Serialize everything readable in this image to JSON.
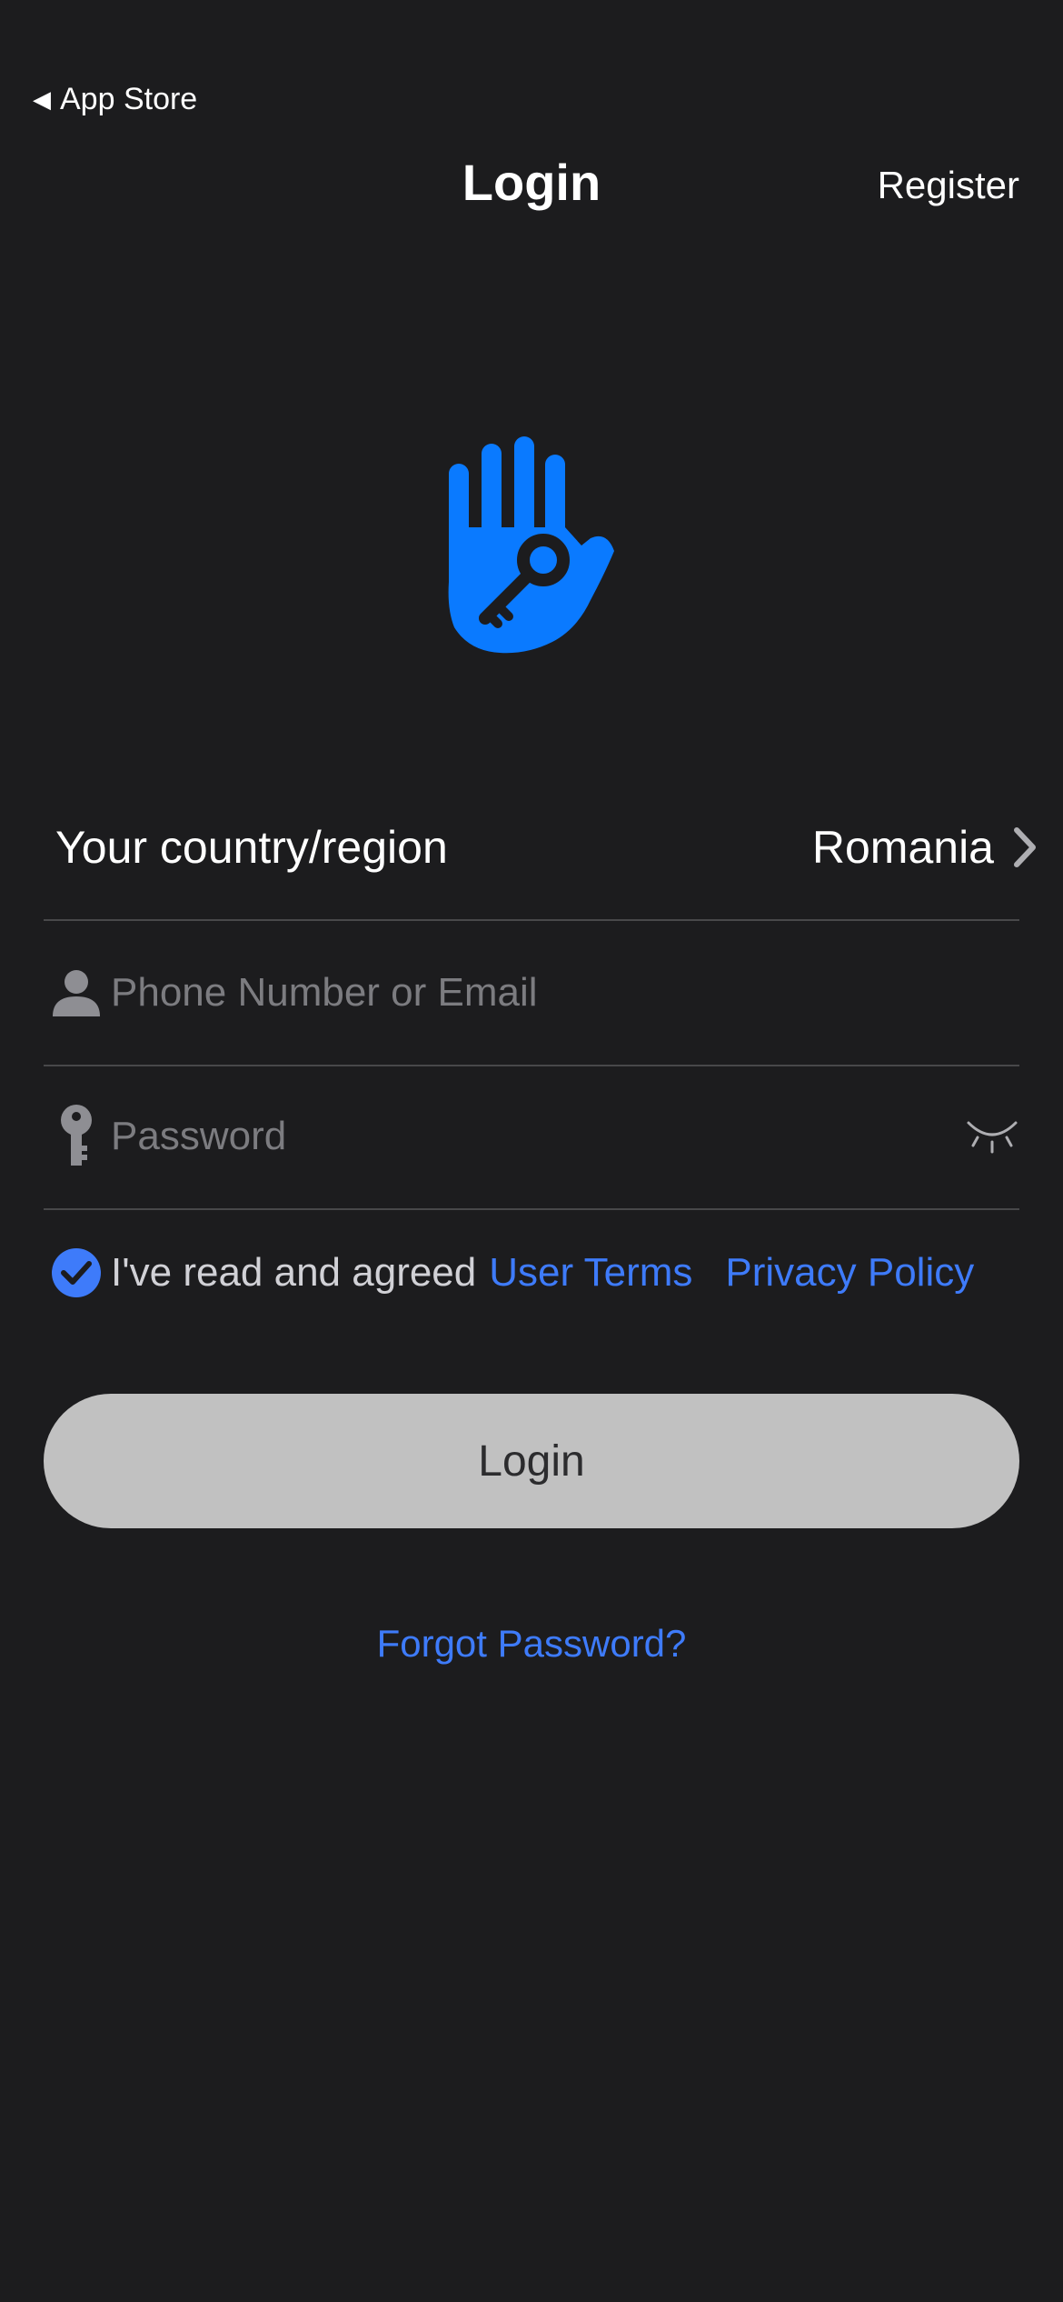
{
  "status": {
    "back_label": "App Store"
  },
  "nav": {
    "title": "Login",
    "register_label": "Register"
  },
  "form": {
    "country_label": "Your country/region",
    "country_value": "Romania",
    "phone_placeholder": "Phone Number or Email",
    "password_placeholder": "Password"
  },
  "agreement": {
    "checked": true,
    "text": "I've read and agreed",
    "terms_label": "User Terms",
    "privacy_label": "Privacy Policy"
  },
  "actions": {
    "login_label": "Login",
    "forgot_label": "Forgot Password?"
  },
  "colors": {
    "accent": "#3e7bfa",
    "logo": "#0a7aff",
    "background": "#1c1c1e",
    "button": "#c1c1c1"
  },
  "icons": [
    "back-triangle-icon",
    "hand-key-logo-icon",
    "chevron-right-icon",
    "person-icon",
    "key-icon",
    "eye-closed-icon",
    "checkmark-circle-icon"
  ]
}
